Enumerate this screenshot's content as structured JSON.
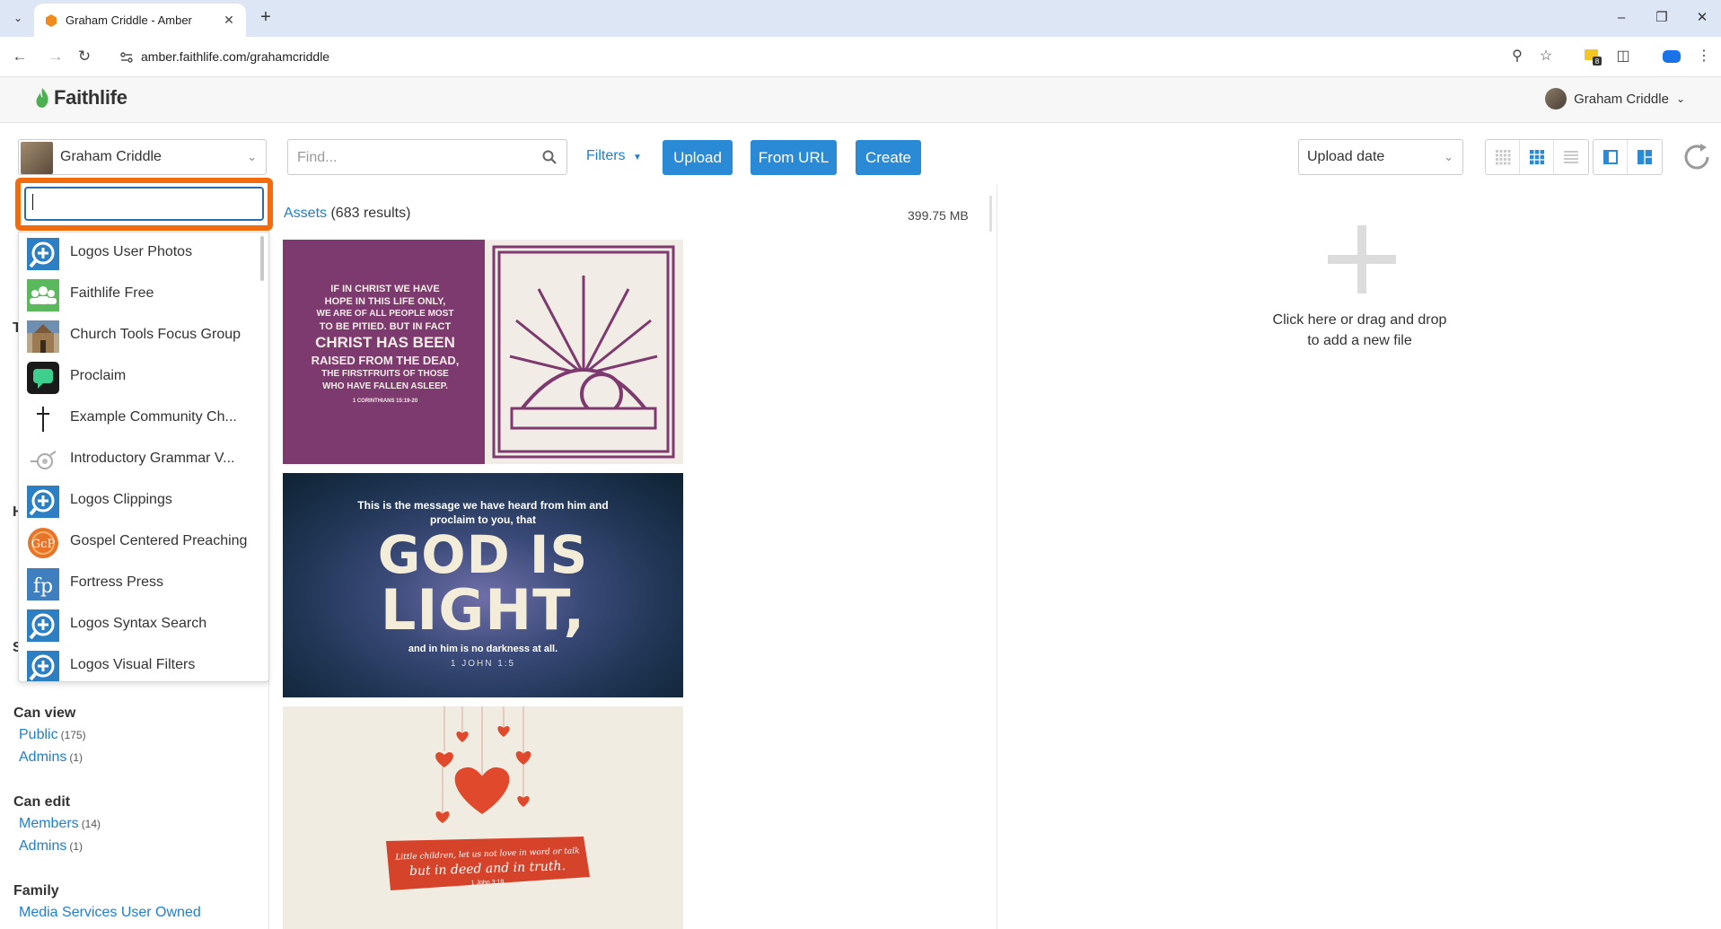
{
  "browser": {
    "tab_title": "Graham Criddle - Amber",
    "url": "amber.faithlife.com/grahamcriddle",
    "extension_badge": "8"
  },
  "header": {
    "logo_text": "Faithlife",
    "user_name": "Graham Criddle"
  },
  "toolbar": {
    "account_name": "Graham Criddle",
    "find_placeholder": "Find...",
    "filters_label": "Filters",
    "upload_label": "Upload",
    "from_url_label": "From URL",
    "create_label": "Create",
    "sort_label": "Upload date"
  },
  "dropdown": {
    "search_value": "",
    "items": [
      {
        "label": "Logos User Photos",
        "icon": "logos-icon"
      },
      {
        "label": "Faithlife Free",
        "icon": "group-icon"
      },
      {
        "label": "Church Tools Focus Group",
        "icon": "church-building-icon"
      },
      {
        "label": "Proclaim",
        "icon": "proclaim-icon"
      },
      {
        "label": "Example Community Ch...",
        "icon": "cross-icon"
      },
      {
        "label": "Introductory Grammar V...",
        "icon": "grammar-icon"
      },
      {
        "label": "Logos Clippings",
        "icon": "logos-icon"
      },
      {
        "label": "Gospel Centered Preaching",
        "icon": "gcp-icon"
      },
      {
        "label": "Fortress Press",
        "icon": "fortress-press-icon"
      },
      {
        "label": "Logos Syntax Search",
        "icon": "logos-icon"
      },
      {
        "label": "Logos Visual Filters",
        "icon": "logos-icon"
      }
    ]
  },
  "sidebar": {
    "can_view": {
      "heading": "Can view",
      "items": [
        {
          "label": "Public",
          "count": "(175)"
        },
        {
          "label": "Admins",
          "count": "(1)"
        }
      ]
    },
    "can_edit": {
      "heading": "Can edit",
      "items": [
        {
          "label": "Members",
          "count": "(14)"
        },
        {
          "label": "Admins",
          "count": "(1)"
        }
      ]
    },
    "family": {
      "heading": "Family",
      "items": [
        {
          "label": "Media Services User Owned"
        }
      ]
    }
  },
  "assets": {
    "title": "Assets",
    "results": "(683 results)",
    "total_size": "399.75 MB",
    "thumbnails": [
      {
        "lines": [
          "IF IN CHRIST WE HAVE",
          "HOPE IN THIS LIFE ONLY,",
          "WE ARE OF ALL PEOPLE MOST",
          "TO BE PITIED. BUT IN FACT",
          "CHRIST HAS BEEN",
          "RAISED FROM THE DEAD,",
          "THE FIRSTFRUITS OF THOSE",
          "WHO HAVE FALLEN ASLEEP."
        ],
        "ref": "1 CORINTHIANS 15:19-20"
      },
      {
        "top": "This is the message we have heard from him and proclaim to you, that",
        "big1": "GOD IS",
        "big2": "LIGHT,",
        "bottom": "and in him is no darkness at all.",
        "ref": "1 JOHN 1:5"
      },
      {
        "line1": "Little children, let us not love in word or talk",
        "line2": "but in deed and in truth.",
        "ref": "1 John 3:18"
      }
    ]
  },
  "upload_zone": {
    "line1": "Click here or drag and drop",
    "line2": "to add a new file"
  },
  "colors": {
    "accent_blue": "#2a8ad6",
    "link_blue": "#1e7fd0",
    "highlight_orange": "#f26c0d"
  }
}
